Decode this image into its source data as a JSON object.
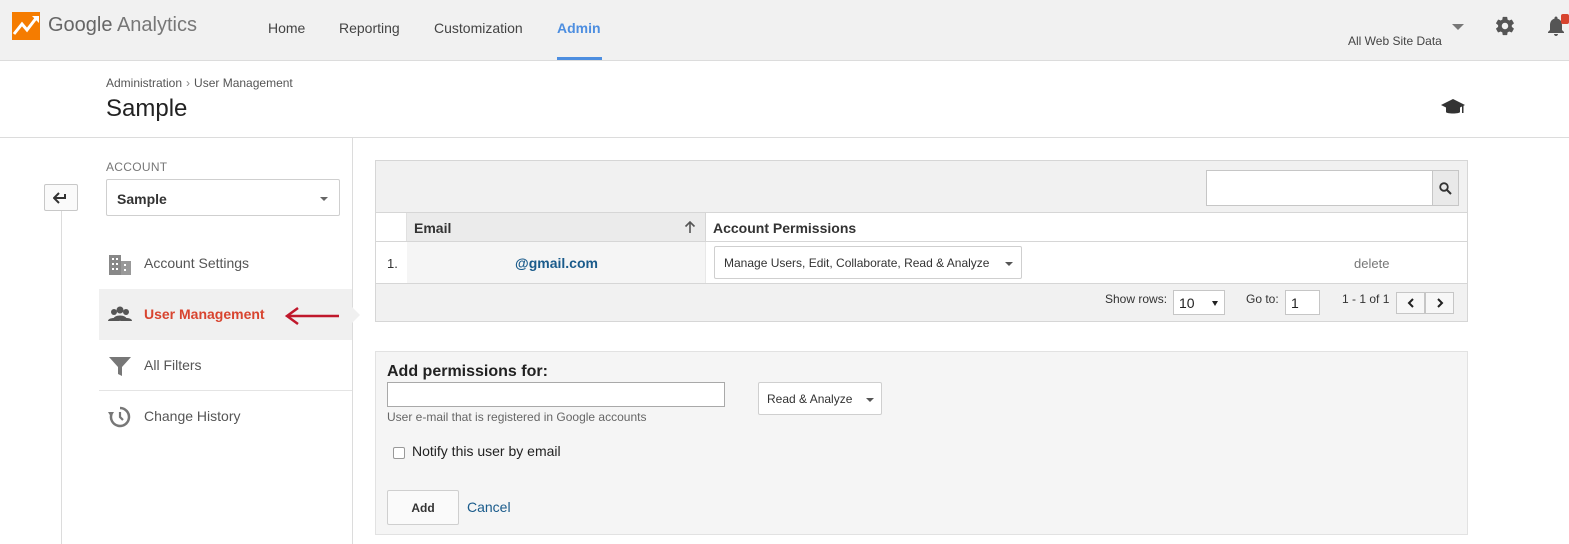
{
  "app": {
    "brand_google": "Google",
    "brand_product": "Analytics",
    "nav": [
      {
        "label": "Home"
      },
      {
        "label": "Reporting"
      },
      {
        "label": "Customization"
      },
      {
        "label": "Admin",
        "active": true
      }
    ],
    "view_picker": "All Web Site Data",
    "icons": [
      "analytics-logo-icon",
      "gear-icon",
      "notification-bell-icon"
    ],
    "accent_color": "#4d8ee0"
  },
  "header": {
    "breadcrumb": [
      "Administration",
      "User Management"
    ],
    "breadcrumb_sep": "›",
    "title": "Sample",
    "help_icon": "graduation-cap-icon"
  },
  "sidebar": {
    "account_label": "ACCOUNT",
    "account_value": "Sample",
    "items": [
      {
        "label": "Account Settings",
        "icon": "building-icon"
      },
      {
        "label": "User Management",
        "icon": "users-icon",
        "active": true
      },
      {
        "label": "All Filters",
        "icon": "filter-icon"
      },
      {
        "label": "Change History",
        "icon": "history-icon"
      }
    ],
    "active_color": "#d8442f"
  },
  "users_table": {
    "columns": [
      "Email",
      "Account Permissions"
    ],
    "rows": [
      {
        "num": "1.",
        "email": "@gmail.com",
        "permissions": "Manage Users, Edit, Collaborate, Read & Analyze",
        "action": "delete"
      }
    ],
    "show_rows_label": "Show rows:",
    "show_rows_value": "10",
    "goto_label": "Go to:",
    "goto_value": "1",
    "range": "1 - 1 of 1"
  },
  "add_permissions": {
    "title": "Add permissions for:",
    "email_help": "User e-mail that is registered in Google accounts",
    "role": "Read & Analyze",
    "notify_label": "Notify this user by email",
    "add_label": "Add",
    "cancel_label": "Cancel"
  }
}
